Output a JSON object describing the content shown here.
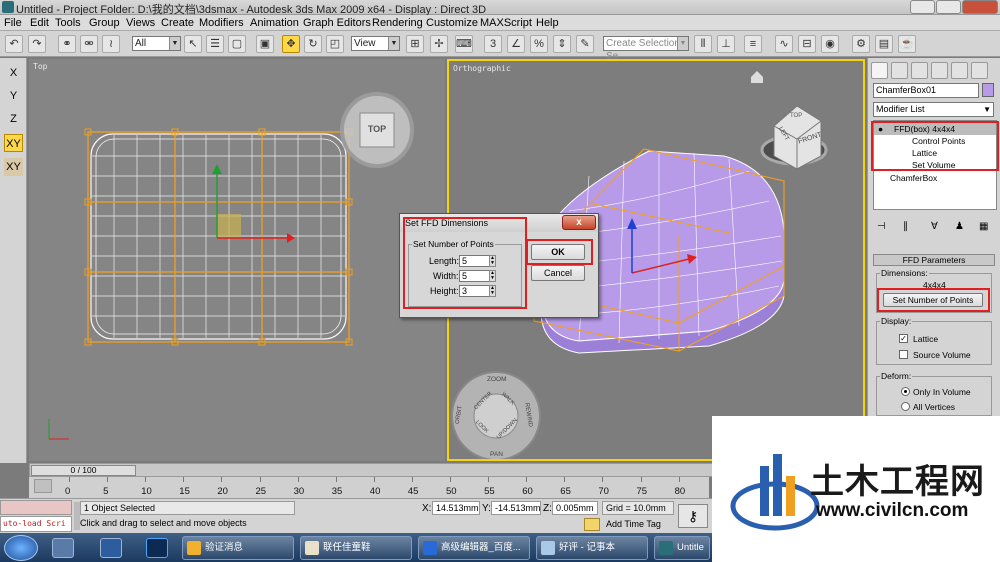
{
  "window": {
    "title": "Untitled     - Project Folder: D:\\我的文档\\3dsmax     - Autodesk 3ds Max  2009 x64       - Display : Direct 3D"
  },
  "menu": [
    "File",
    "Edit",
    "Tools",
    "Group",
    "Views",
    "Create",
    "Modifiers",
    "Animation",
    "Graph Editors",
    "Rendering",
    "Customize",
    "MAXScript",
    "Help"
  ],
  "toolbar": {
    "selection_filter": "All",
    "ref_coord": "View",
    "selection_set_placeholder": "Create Selection Se"
  },
  "axis_buttons": [
    "X",
    "Y",
    "Z",
    "XY",
    "XY"
  ],
  "viewports": {
    "top": {
      "label": "Top",
      "viewcube": "TOP"
    },
    "ortho": {
      "label": "Orthographic",
      "viewcube_faces": [
        "TOP",
        "FRONT",
        "LEFT"
      ]
    }
  },
  "steering_wheel": [
    "ZOOM",
    "ORBIT",
    "CENTER",
    "WALK",
    "REWIND",
    "LOOK",
    "UP/DOWN",
    "PAN"
  ],
  "command_panel": {
    "object_name": "ChamferBox01",
    "modifier_list": "Modifier List",
    "stack": {
      "modifier": "FFD(box) 4x4x4",
      "subobjects": [
        "Control Points",
        "Lattice",
        "Set Volume"
      ],
      "base": "ChamferBox"
    },
    "rollout_title": "FFD Parameters",
    "dimensions_label": "Dimensions:",
    "dimensions_value": "4x4x4",
    "set_points_button": "Set Number of Points",
    "display_label": "Display:",
    "lattice_label": "Lattice",
    "source_volume_label": "Source Volume",
    "deform_label": "Deform:",
    "only_in_volume_label": "Only In Volume",
    "all_vertices_label": "All Vertices"
  },
  "dialog": {
    "title": "Set FFD Dimensions",
    "group_label": "Set Number of Points",
    "length_label": "Length:",
    "length_value": "5",
    "width_label": "Width:",
    "width_value": "5",
    "height_label": "Height:",
    "height_value": "3",
    "ok_label": "OK",
    "cancel_label": "Cancel",
    "close_glyph": "x"
  },
  "timeline": {
    "slider_label": "0 / 100",
    "ticks": [
      "0",
      "5",
      "10",
      "15",
      "20",
      "25",
      "30",
      "35",
      "40",
      "45",
      "50",
      "55",
      "60",
      "65",
      "70",
      "75",
      "80"
    ]
  },
  "status": {
    "maxscript_label": "uto-load Scri",
    "selection_text": "1 Object Selected",
    "prompt_text": "Click and drag to select and move objects",
    "x_label": "X:",
    "x_value": "14.513mm",
    "y_label": "Y:",
    "y_value": "-14.513mm",
    "z_label": "Z:",
    "z_value": "0.005mm",
    "grid_text": "Grid = 10.0mm",
    "add_time_tag": "Add Time Tag"
  },
  "taskbar": {
    "tasks": [
      "验证消息",
      "联任佳童鞋",
      "高级编辑器_百度...",
      "好评 - 记事本",
      "Untitle"
    ]
  },
  "watermark": {
    "brand": "土木工程网",
    "url": "www.civilcn.com"
  },
  "colors": {
    "highlight_red": "#e02020",
    "active_yellow": "#f5d400",
    "lattice_orange": "#f0a020",
    "object_purple": "#b79be8"
  }
}
